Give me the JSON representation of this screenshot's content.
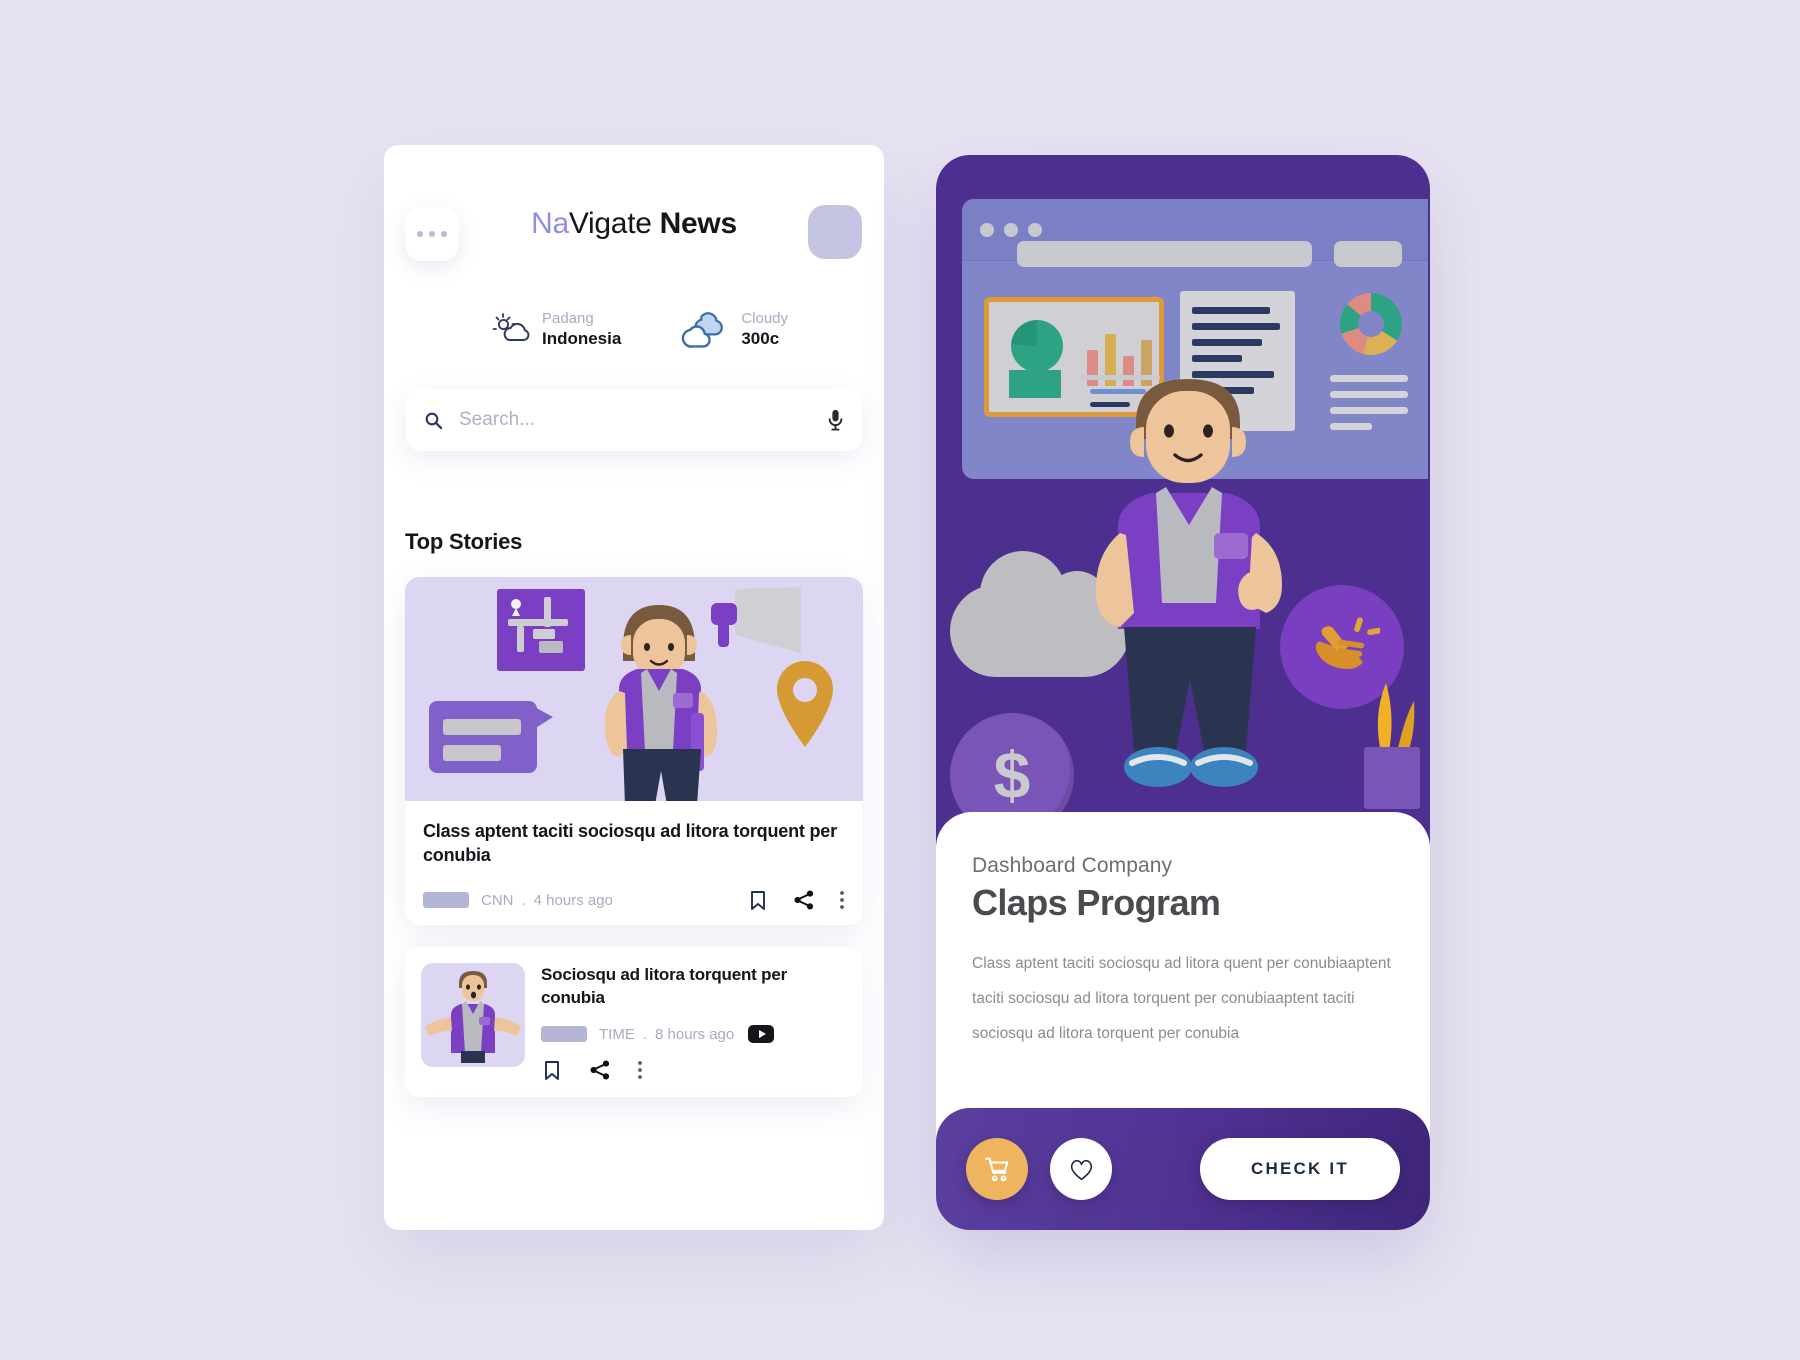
{
  "background_color": "#e7e3f2",
  "left_phone": {
    "header": {
      "menu_icon": "three-dots-icon",
      "brand_part1": "Na",
      "brand_part2": "Vigate",
      "brand_part3": "News",
      "brand_accent_color": "#8e8fe0",
      "avatar_label": ""
    },
    "weather": [
      {
        "icon": "sun-behind-cloud-icon",
        "top": "Padang",
        "bottom": "Indonesia"
      },
      {
        "icon": "cloud-icon",
        "top": "Cloudy",
        "bottom": "300c"
      }
    ],
    "search": {
      "icon": "search-icon",
      "placeholder": "Search...",
      "value": "",
      "mic_icon": "microphone-icon"
    },
    "section_title": "Top Stories",
    "stories": [
      {
        "title": "Class aptent taciti sociosqu ad litora torquent per conubia",
        "source": "CNN",
        "separator": ".",
        "time": "4 hours ago",
        "bookmark_icon": "bookmark-icon",
        "share_icon": "share-icon",
        "more_icon": "kebab-menu-icon",
        "illustration": "3d-character-with-map-megaphone-chat-pin"
      },
      {
        "title": "Sociosqu ad litora torquent per conubia",
        "source": "TIME",
        "separator": ".",
        "time": "8 hours ago",
        "video_badge": "youtube-play-icon",
        "bookmark_icon": "bookmark-icon",
        "share_icon": "share-icon",
        "more_icon": "kebab-menu-icon",
        "thumbnail": "3d-character-thumbnail"
      }
    ]
  },
  "right_phone": {
    "accent_purple": "#4c2f8e",
    "hero": {
      "browser_mockup": "browser-window-illustration",
      "dashboard_icons": [
        "pie-chart",
        "bar-chart",
        "donut-chart",
        "document-lines"
      ],
      "cloud": "cloud-shape",
      "coin_symbol": "$",
      "clap_icon": "clapping-hands-icon",
      "plant": "plant-illustration",
      "character": "3d-character-thumbs-up"
    },
    "kicker": "Dashboard Company",
    "headline": "Claps Program",
    "paragraph": "Class aptent taciti sociosqu ad litora quent per conubiaaptent taciti sociosqu ad litora torquent per conubiaaptent taciti sociosqu ad litora torquent per conubia",
    "actions": {
      "cart_icon": "shopping-cart-icon",
      "cart_color": "#eeb45e",
      "heart_icon": "heart-icon",
      "check_label": "CHECK IT"
    }
  }
}
